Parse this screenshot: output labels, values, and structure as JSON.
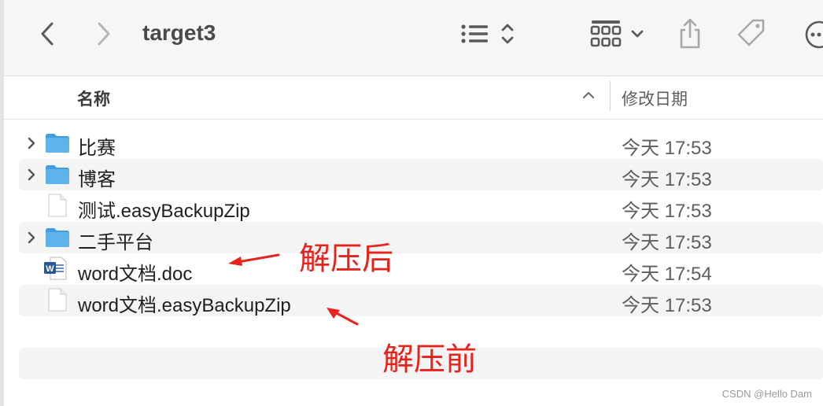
{
  "window": {
    "title": "target3"
  },
  "toolbar": {
    "back_icon": "chevron-left-icon",
    "forward_icon": "chevron-right-icon",
    "view_list_icon": "list-view-icon",
    "view_toggle_icon": "up-down-chevron-icon",
    "group_icon": "grid-group-icon",
    "group_dropdown_icon": "chevron-down-icon",
    "share_icon": "share-icon",
    "tag_icon": "tag-icon",
    "more_icon": "ellipsis-circle-icon"
  },
  "columns": {
    "name": "名称",
    "date_modified": "修改日期"
  },
  "files": [
    {
      "name": "比赛",
      "type": "folder",
      "date": "今天 17:53"
    },
    {
      "name": "博客",
      "type": "folder",
      "date": "今天 17:53"
    },
    {
      "name": "测试.easyBackupZip",
      "type": "file",
      "date": "今天 17:53"
    },
    {
      "name": "二手平台",
      "type": "folder",
      "date": "今天 17:53"
    },
    {
      "name": "word文档.doc",
      "type": "word",
      "date": "今天 17:54"
    },
    {
      "name": "word文档.easyBackupZip",
      "type": "file",
      "date": "今天 17:53"
    }
  ],
  "annotations": {
    "after": "解压后",
    "before": "解压前"
  },
  "watermark": "CSDN @Hello Dam",
  "colors": {
    "annotation": "#e8231d",
    "folder": "#5db3ea",
    "word": "#2b5797"
  }
}
